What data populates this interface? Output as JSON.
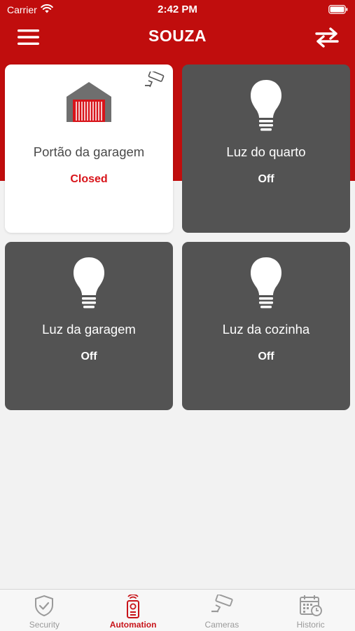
{
  "status_bar": {
    "carrier": "Carrier",
    "time": "2:42 PM"
  },
  "header": {
    "title": "SOUZA",
    "menu_icon": "hamburger-menu-icon",
    "swap_icon": "swap-arrows-icon"
  },
  "devices": [
    {
      "name": "Portão da garagem",
      "state": "Closed",
      "icon": "garage-door-icon",
      "active": true,
      "has_camera": true
    },
    {
      "name": "Luz do quarto",
      "state": "Off",
      "icon": "light-bulb-icon",
      "active": false
    },
    {
      "name": "Luz da garagem",
      "state": "Off",
      "icon": "light-bulb-icon",
      "active": false
    },
    {
      "name": "Luz da cozinha",
      "state": "Off",
      "icon": "light-bulb-icon",
      "active": false
    }
  ],
  "tabs": [
    {
      "label": "Security",
      "icon": "shield-check-icon",
      "active": false
    },
    {
      "label": "Automation",
      "icon": "remote-control-icon",
      "active": true
    },
    {
      "label": "Cameras",
      "icon": "security-camera-icon",
      "active": false
    },
    {
      "label": "Historic",
      "icon": "calendar-clock-icon",
      "active": false
    }
  ],
  "colors": {
    "brand_red": "#c00d0d",
    "active_text": "#d8141a",
    "card_dark": "#535353"
  }
}
